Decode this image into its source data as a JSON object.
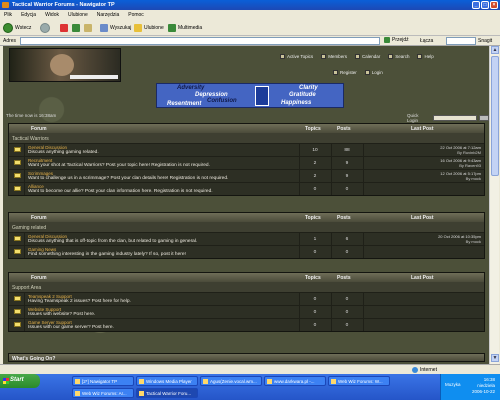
{
  "window": {
    "title": "Tactical Warrior Forums - Nawigator TP"
  },
  "menu": [
    "Plik",
    "Edycja",
    "Widok",
    "Ulubione",
    "Narzędzia",
    "Pomoc"
  ],
  "nav": {
    "back": "Wstecz",
    "search": "Wyszukaj",
    "favorites": "Ulubione",
    "multimedia": "Multimedia"
  },
  "address": {
    "label": "Adres",
    "go": "Przejdź",
    "links": "Łącza",
    "search_btn": "Snagit"
  },
  "forum": {
    "top_links_1": [
      "Active Topics",
      "Members",
      "Calendar",
      "Search",
      "Help"
    ],
    "top_links_2": [
      "Register",
      "Login"
    ],
    "ad_words": {
      "w1": "Adversity",
      "w2": "Depression",
      "w3": "Confusion",
      "w4": "Resentment",
      "w5": "Clarity",
      "w6": "Gratitude",
      "w7": "Happiness"
    },
    "time_text": "The time now is 16:38am",
    "quick_login": "Quick Login",
    "col_forum": "Forum",
    "col_topics": "Topics",
    "col_posts": "Posts",
    "col_last": "Last Post",
    "sections": [
      {
        "category": "Tactical Warriors",
        "rows": [
          {
            "name": "General Discussion",
            "desc": "Discuss anything gaming related.",
            "topics": "10",
            "posts": "88",
            "lp1": "22 Oct 2006 at 7:12am",
            "lp2": "By Ruvinb2M"
          },
          {
            "name": "Recruitment",
            "desc": "Want your shot at Tactical Warriors? Post your topic here! Registration is not required.",
            "topics": "2",
            "posts": "9",
            "lp1": "16 Oct 2006 at 9:43am",
            "lp2": "By Raven93"
          },
          {
            "name": "Scrimmages",
            "desc": "Want to challenge us in a scrimmage? Post your clan details here! Registration is not required.",
            "topics": "2",
            "posts": "9",
            "lp1": "12 Oct 2006 at 5:17pm",
            "lp2": "By mock"
          },
          {
            "name": "Alliance",
            "desc": "Want to become our allie? Post your clan information here. Registration is not required.",
            "topics": "0",
            "posts": "0",
            "lp1": "",
            "lp2": ""
          }
        ]
      },
      {
        "category": "Gaming related",
        "rows": [
          {
            "name": "General Discussion",
            "desc": "Discuss anything that is off-topic from the clan, but related to gaming in general.",
            "topics": "1",
            "posts": "6",
            "lp1": "20 Oct 2006 at 10:35pm",
            "lp2": "By mock"
          },
          {
            "name": "Gaming News",
            "desc": "Find something interesting in the gaming industry lately? If so, post it here!",
            "topics": "0",
            "posts": "0",
            "lp1": "",
            "lp2": ""
          }
        ]
      },
      {
        "category": "Support Area",
        "rows": [
          {
            "name": "Teamspeak 2 Support",
            "desc": "Having Teamspeak 2 issues? Post here for help.",
            "topics": "0",
            "posts": "0",
            "lp1": "",
            "lp2": ""
          },
          {
            "name": "Website Support",
            "desc": "Issues with website? Post here.",
            "topics": "0",
            "posts": "0",
            "lp1": "",
            "lp2": ""
          },
          {
            "name": "Game Server Support",
            "desc": "Issues with our game server? Post here.",
            "topics": "0",
            "posts": "0",
            "lp1": "",
            "lp2": ""
          }
        ]
      }
    ],
    "footer_head": "What's Going On?"
  },
  "status": {
    "zone": "Internet"
  },
  "taskbar": {
    "start": "Start",
    "tasks": [
      "[2*] Nawigator TP",
      "Windows Media Player",
      "Agus(Zenie.vocal.wm...",
      "www.darkwara.pl -...",
      "Web Wiz Forums: W...",
      "Web Wiz Forums: Ar...",
      "Tactical Warrior Foru..."
    ],
    "lang": "Muzyka",
    "time": "16:38",
    "day": "niedziela",
    "date": "2006-10-22"
  }
}
